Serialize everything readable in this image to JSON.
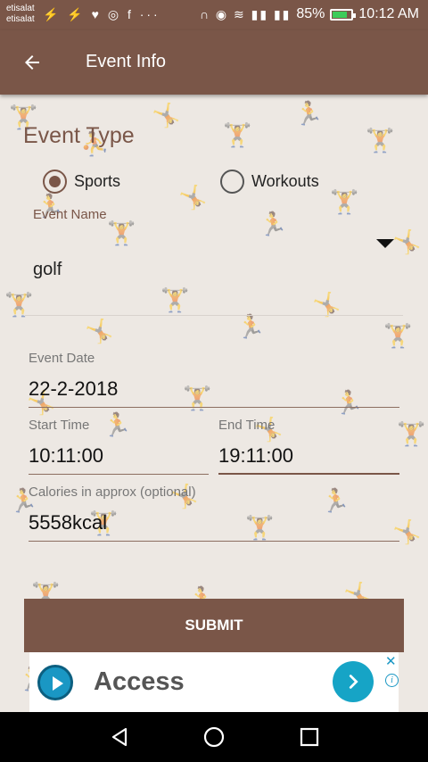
{
  "status_bar": {
    "carrier_1": "etisalat",
    "carrier_2": "etisalat",
    "left_icons": "⚡ ⚡ ♥ ◎ f ···",
    "right_icons": "∩ ◉ ≋ ▮▮ ▮▮",
    "battery_percent": "85%",
    "time": "10:12 AM"
  },
  "app_bar": {
    "title": "Event Info",
    "back_icon": "arrow-left"
  },
  "form": {
    "section_title": "Event Type",
    "event_type_options": [
      {
        "label": "Sports",
        "selected": true
      },
      {
        "label": "Workouts",
        "selected": false
      }
    ],
    "event_name_label": "Event Name",
    "event_name_value": "golf",
    "event_date_label": "Event Date",
    "event_date_value": "22-2-2018",
    "start_time_label": "Start Time",
    "start_time_value": "10:11:00",
    "end_time_label": "End Time",
    "end_time_value": "19:11:00",
    "calories_label": "Calories in approx (optional)",
    "calories_value": "5558kcal",
    "submit_label": "SUBMIT"
  },
  "ad": {
    "text": "Access",
    "next_icon": "chevron-right",
    "close_icon": "close",
    "info_icon": "info"
  },
  "nav_bar": {
    "back_icon": "triangle-back",
    "home_icon": "circle-home",
    "recent_icon": "square-recent"
  },
  "colors": {
    "primary": "#7a5648",
    "background": "#ede8e3",
    "ad_accent": "#16a4c6"
  }
}
